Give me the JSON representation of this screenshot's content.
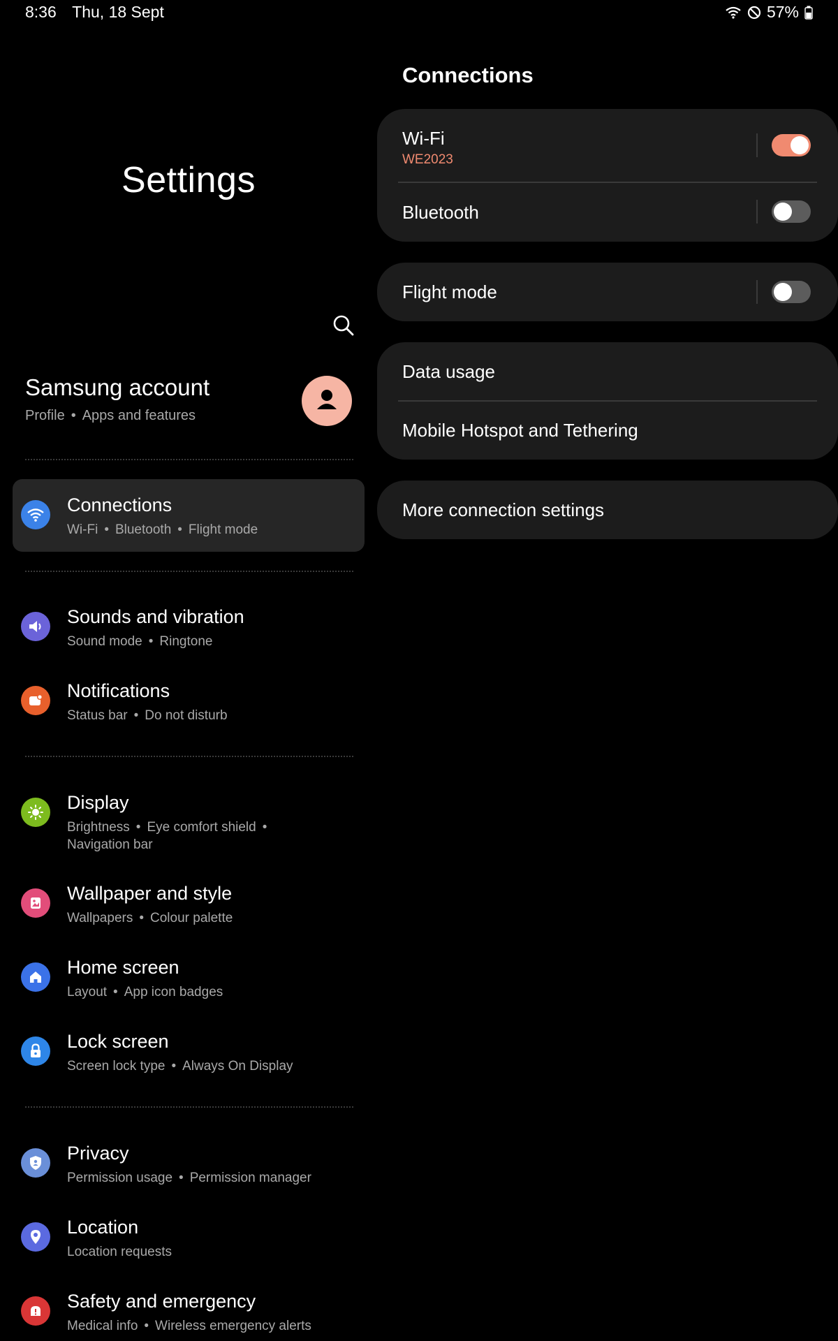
{
  "status_bar": {
    "time": "8:36",
    "date": "Thu, 18 Sept",
    "battery": "57%"
  },
  "left": {
    "title": "Settings",
    "account": {
      "name": "Samsung account",
      "sub": [
        "Profile",
        "Apps and features"
      ]
    },
    "items": [
      {
        "title": "Connections",
        "sub": [
          "Wi-Fi",
          "Bluetooth",
          "Flight mode"
        ],
        "icon": "wifi-icon",
        "color": "#3b82e8",
        "selected": true
      },
      {
        "title": "Sounds and vibration",
        "sub": [
          "Sound mode",
          "Ringtone"
        ],
        "icon": "volume-icon",
        "color": "#6b63d9"
      },
      {
        "title": "Notifications",
        "sub": [
          "Status bar",
          "Do not disturb"
        ],
        "icon": "notification-icon",
        "color": "#e8602c"
      },
      {
        "title": "Display",
        "sub": [
          "Brightness",
          "Eye comfort shield",
          "Navigation bar"
        ],
        "icon": "sun-icon",
        "color": "#7dbb1e"
      },
      {
        "title": "Wallpaper and style",
        "sub": [
          "Wallpapers",
          "Colour palette"
        ],
        "icon": "wallpaper-icon",
        "color": "#e24d7a"
      },
      {
        "title": "Home screen",
        "sub": [
          "Layout",
          "App icon badges"
        ],
        "icon": "home-icon",
        "color": "#3b72e8"
      },
      {
        "title": "Lock screen",
        "sub": [
          "Screen lock type",
          "Always On Display"
        ],
        "icon": "lock-icon",
        "color": "#2e86e8"
      },
      {
        "title": "Privacy",
        "sub": [
          "Permission usage",
          "Permission manager"
        ],
        "icon": "privacy-shield-icon",
        "color": "#6a8fd8"
      },
      {
        "title": "Location",
        "sub": [
          "Location requests"
        ],
        "icon": "location-pin-icon",
        "color": "#5b6ae0"
      },
      {
        "title": "Safety and emergency",
        "sub": [
          "Medical info",
          "Wireless emergency alerts"
        ],
        "icon": "emergency-icon",
        "color": "#d93636"
      }
    ]
  },
  "right": {
    "title": "Connections",
    "wifi": {
      "label": "Wi-Fi",
      "network": "WE2023",
      "on": true
    },
    "bluetooth": {
      "label": "Bluetooth",
      "on": false
    },
    "flight": {
      "label": "Flight mode",
      "on": false
    },
    "data_usage": {
      "label": "Data usage"
    },
    "hotspot": {
      "label": "Mobile Hotspot and Tethering"
    },
    "more": {
      "label": "More connection settings"
    }
  },
  "colors": {
    "accent": "#f08a70",
    "card_bg": "#1c1c1c",
    "selected_bg": "#262626"
  }
}
